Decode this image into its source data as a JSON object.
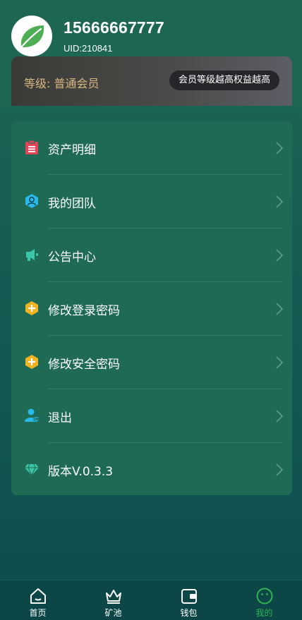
{
  "profile": {
    "phone": "15666667777",
    "uid": "UID:210841",
    "avatar_icon": "leaf-icon"
  },
  "level": {
    "text": "等级: 普通会员",
    "pill": "会员等级越高权益越高"
  },
  "menu": {
    "items": [
      {
        "label": "资产明细",
        "icon": "clipboard-icon"
      },
      {
        "label": "我的团队",
        "icon": "team-icon"
      },
      {
        "label": "公告中心",
        "icon": "megaphone-icon"
      },
      {
        "label": "修改登录密码",
        "icon": "hex-plus-icon"
      },
      {
        "label": "修改安全密码",
        "icon": "hex-plus-icon"
      },
      {
        "label": "退出",
        "icon": "user-icon"
      },
      {
        "label": "版本V.0.3.3",
        "icon": "diamond-icon"
      }
    ]
  },
  "tabbar": {
    "tabs": [
      {
        "label": "首页",
        "icon": "home-icon"
      },
      {
        "label": "矿池",
        "icon": "crown-icon"
      },
      {
        "label": "钱包",
        "icon": "wallet-icon"
      },
      {
        "label": "我的",
        "icon": "smiley-icon"
      }
    ],
    "active_index": 3
  },
  "colors": {
    "background": "#185f54",
    "card": "#1e6a55",
    "level_text": "#d9b982",
    "active_tab": "#2fb454"
  }
}
